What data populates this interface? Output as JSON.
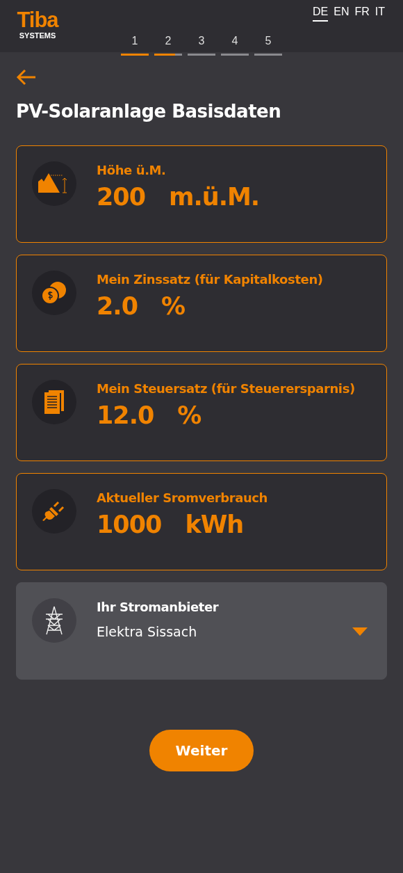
{
  "brand": {
    "name": "Tiba",
    "sub": "SYSTEMS"
  },
  "languages": [
    {
      "label": "DE",
      "selected": true
    },
    {
      "label": "EN",
      "selected": false
    },
    {
      "label": "FR",
      "selected": false
    },
    {
      "label": "IT",
      "selected": false
    }
  ],
  "steps": [
    {
      "label": "1",
      "level": 1
    },
    {
      "label": "2",
      "level": 0.75
    },
    {
      "label": "3",
      "level": 0
    },
    {
      "label": "4",
      "level": 0
    },
    {
      "label": "5",
      "level": 0
    }
  ],
  "title": "PV-Solaranlage Basisdaten",
  "fields": [
    {
      "kind": "input",
      "label": "Höhe ü.M.",
      "value": "200",
      "unit": "m.ü.M."
    },
    {
      "kind": "input",
      "label": "Mein Zinssatz (für Kapitalkosten)",
      "value": "2.0",
      "unit": "%"
    },
    {
      "kind": "input",
      "label": "Mein Steuersatz (für Steuerersparnis)",
      "value": "12.0",
      "unit": "%"
    },
    {
      "kind": "input",
      "label": "Aktueller Sromverbrauch",
      "value": "1000",
      "unit": "kWh"
    },
    {
      "kind": "select",
      "label": "Ihr Stromanbieter",
      "value": "Elektra Sissach"
    }
  ],
  "next_button": "Weiter"
}
